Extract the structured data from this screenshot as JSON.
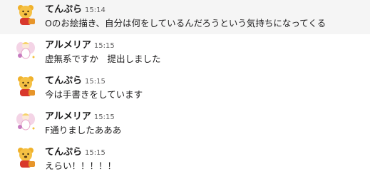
{
  "messages": [
    {
      "user": "てんぷら",
      "time": "15:14",
      "text": "Oのお絵描き、自分は何をしているんだろうという気持ちになってくる",
      "avatar": "bear-avatar-icon"
    },
    {
      "user": "アルメリア",
      "time": "15:15",
      "text": "虚無系ですか　提出しました",
      "avatar": "fairy-avatar-icon"
    },
    {
      "user": "てんぷら",
      "time": "15:15",
      "text": "今は手書きをしています",
      "avatar": "bear-avatar-icon"
    },
    {
      "user": "アルメリア",
      "time": "15:15",
      "text": "F通りましたあああ",
      "avatar": "fairy-avatar-icon"
    },
    {
      "user": "てんぷら",
      "time": "15:15",
      "text": "えらい！！！！！",
      "avatar": "bear-avatar-icon"
    }
  ],
  "colors": {
    "hover_bg": "#f5f5f5",
    "text": "#1d1c1d",
    "timestamp": "#616061",
    "bear": "#f0b12a",
    "fairy_wing": "#e7a6c9"
  }
}
